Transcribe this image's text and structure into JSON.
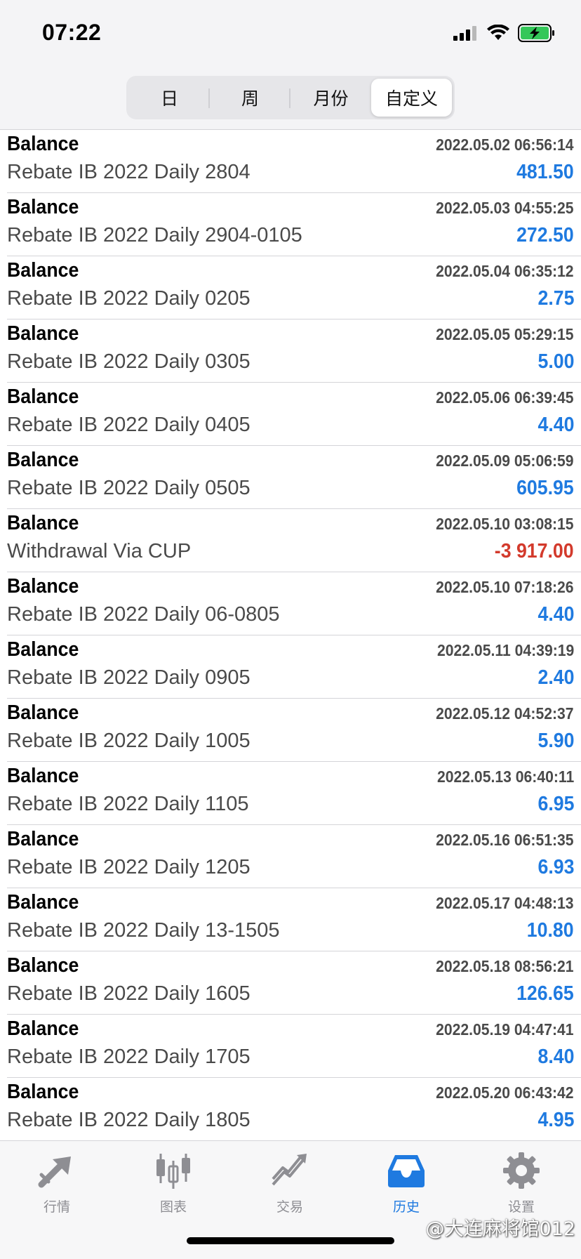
{
  "status_bar": {
    "time": "07:22"
  },
  "segments": [
    {
      "label": "日",
      "active": false
    },
    {
      "label": "周",
      "active": false
    },
    {
      "label": "月份",
      "active": false
    },
    {
      "label": "自定义",
      "active": true
    }
  ],
  "deals": [
    {
      "type": "Balance",
      "date": "2022.05.02 06:56:14",
      "comment": "Rebate IB 2022 Daily 2804",
      "amount": "481.50",
      "negative": false
    },
    {
      "type": "Balance",
      "date": "2022.05.03 04:55:25",
      "comment": "Rebate IB 2022 Daily 2904-0105",
      "amount": "272.50",
      "negative": false
    },
    {
      "type": "Balance",
      "date": "2022.05.04 06:35:12",
      "comment": "Rebate IB 2022 Daily 0205",
      "amount": "2.75",
      "negative": false
    },
    {
      "type": "Balance",
      "date": "2022.05.05 05:29:15",
      "comment": "Rebate IB 2022 Daily 0305",
      "amount": "5.00",
      "negative": false
    },
    {
      "type": "Balance",
      "date": "2022.05.06 06:39:45",
      "comment": "Rebate IB 2022 Daily 0405",
      "amount": "4.40",
      "negative": false
    },
    {
      "type": "Balance",
      "date": "2022.05.09 05:06:59",
      "comment": "Rebate IB 2022 Daily 0505",
      "amount": "605.95",
      "negative": false
    },
    {
      "type": "Balance",
      "date": "2022.05.10 03:08:15",
      "comment": "Withdrawal Via CUP",
      "amount": "-3 917.00",
      "negative": true
    },
    {
      "type": "Balance",
      "date": "2022.05.10 07:18:26",
      "comment": "Rebate IB 2022 Daily 06-0805",
      "amount": "4.40",
      "negative": false
    },
    {
      "type": "Balance",
      "date": "2022.05.11 04:39:19",
      "comment": "Rebate IB 2022 Daily 0905",
      "amount": "2.40",
      "negative": false
    },
    {
      "type": "Balance",
      "date": "2022.05.12 04:52:37",
      "comment": "Rebate IB 2022 Daily 1005",
      "amount": "5.90",
      "negative": false
    },
    {
      "type": "Balance",
      "date": "2022.05.13 06:40:11",
      "comment": "Rebate IB 2022 Daily 1105",
      "amount": "6.95",
      "negative": false
    },
    {
      "type": "Balance",
      "date": "2022.05.16 06:51:35",
      "comment": "Rebate IB 2022 Daily 1205",
      "amount": "6.93",
      "negative": false
    },
    {
      "type": "Balance",
      "date": "2022.05.17 04:48:13",
      "comment": "Rebate IB 2022 Daily 13-1505",
      "amount": "10.80",
      "negative": false
    },
    {
      "type": "Balance",
      "date": "2022.05.18 08:56:21",
      "comment": "Rebate IB 2022 Daily 1605",
      "amount": "126.65",
      "negative": false
    },
    {
      "type": "Balance",
      "date": "2022.05.19 04:47:41",
      "comment": "Rebate IB 2022 Daily 1705",
      "amount": "8.40",
      "negative": false
    },
    {
      "type": "Balance",
      "date": "2022.05.20 06:43:42",
      "comment": "Rebate IB 2022 Daily 1805",
      "amount": "4.95",
      "negative": false
    }
  ],
  "tabbar": {
    "items": [
      {
        "label": "行情",
        "icon": "quotes-arrow-icon",
        "active": false
      },
      {
        "label": "图表",
        "icon": "candlestick-icon",
        "active": false
      },
      {
        "label": "交易",
        "icon": "trade-chart-icon",
        "active": false
      },
      {
        "label": "历史",
        "icon": "history-inbox-icon",
        "active": true
      },
      {
        "label": "设置",
        "icon": "gear-icon",
        "active": false
      }
    ]
  },
  "watermark": "@大连麻将馆012",
  "colors": {
    "positive": "#1f7ae0",
    "negative": "#d33a2c",
    "tab_active": "#1f7ae0",
    "tab_inactive": "#8e8e93"
  }
}
